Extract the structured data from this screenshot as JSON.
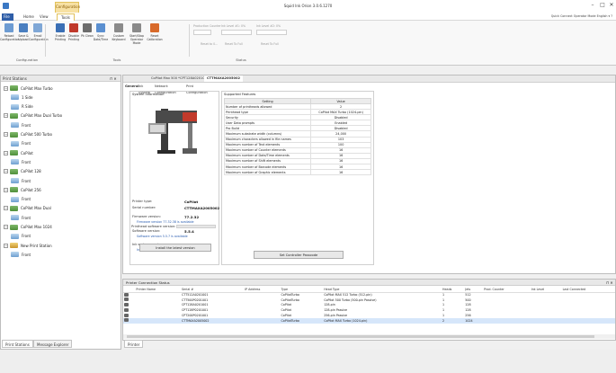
{
  "window": {
    "title": "Squid Ink Orion 3.0.6.1270",
    "context_group": "Configuration",
    "controls": [
      "–",
      "□",
      "✕"
    ]
  },
  "menu": {
    "file": "File ▾",
    "home": "Home",
    "view": "View",
    "tools": "Tools",
    "quick_connect": "Quick Connect  Operator Mode  English ▾  ?"
  },
  "ribbon": {
    "buttons": [
      {
        "label": "Reload Configuration",
        "color": "#6c9bd2"
      },
      {
        "label": "Save & Upload",
        "color": "#4a7fc0"
      },
      {
        "label": "Email Configuration",
        "color": "#7fa7d6"
      },
      {
        "label": "Enable Printing",
        "color": "#3a6fb5"
      },
      {
        "label": "Disable Printing",
        "color": "#c0392b"
      },
      {
        "label": "Pk Clean",
        "color": "#6c6c6c"
      },
      {
        "label": "Sync Date/Time",
        "color": "#5a8fd0"
      },
      {
        "label": "Custom Keyboard",
        "color": "#8a8a8a"
      },
      {
        "label": "Start/Stop Operator Mode",
        "color": "#8a8a8a"
      },
      {
        "label": "Reset Calibration",
        "color": "#d86a2a"
      }
    ],
    "groups": {
      "configuration": "Configuration",
      "tools": "Tools",
      "status": "Status"
    },
    "production_counter": "Production Counter",
    "reset_to": "Reset to 0...",
    "ink_level_1": "Ink Level #1: 0%",
    "ink_level_2": "Ink Level #2: 0%",
    "reset_to_full": "Reset To Full"
  },
  "left_panel": {
    "title": "Print Stations",
    "tree": [
      {
        "label": "CoPilot Max Turbo",
        "type": "printer",
        "level": 0
      },
      {
        "label": "1 Side",
        "type": "head",
        "level": 1
      },
      {
        "label": "R Side",
        "type": "head",
        "level": 1
      },
      {
        "label": "CoPilot Max Dual Turbo",
        "type": "printer",
        "level": 0
      },
      {
        "label": "Front",
        "type": "head",
        "level": 1
      },
      {
        "label": "CoPilot 500 Turbo",
        "type": "printer",
        "level": 0
      },
      {
        "label": "Front",
        "type": "head",
        "level": 1
      },
      {
        "label": "CoPilot",
        "type": "printer",
        "level": 0
      },
      {
        "label": "Front",
        "type": "head",
        "level": 1
      },
      {
        "label": "CoPilot 128",
        "type": "printer",
        "level": 0
      },
      {
        "label": "Front",
        "type": "head",
        "level": 1
      },
      {
        "label": "CoPilot 256",
        "type": "printer",
        "level": 0
      },
      {
        "label": "Front",
        "type": "head",
        "level": 1
      },
      {
        "label": "CoPilot Max Dual",
        "type": "printer",
        "level": 0
      },
      {
        "label": "Front",
        "type": "head",
        "level": 1
      },
      {
        "label": "CoPilot Max 1024",
        "type": "printer",
        "level": 0
      },
      {
        "label": "Front",
        "type": "head",
        "level": 1
      },
      {
        "label": "New Print Station",
        "type": "station",
        "level": 0
      },
      {
        "label": "Front",
        "type": "head",
        "level": 1
      }
    ],
    "tabs": [
      "Print Stations",
      "Message Explorer"
    ]
  },
  "doc_tabs": [
    "CoPilot Max 500 *",
    "CPT128A0201001",
    "CTTMAXA2005002"
  ],
  "sub_tabs": [
    "General",
    "Ink System",
    "Network Configuration",
    "Print Configuration"
  ],
  "system_info": {
    "title": "System Information",
    "printer_type_label": "Printer type:",
    "printer_type": "CoPilot",
    "serial_label": "Serial number:",
    "serial": "CTTMAXA2005002",
    "firmware_label": "Firmware version:",
    "firmware": "77.2.32",
    "firmware_note": "Firmware version 77.32.38 is available",
    "software_label": "Software version:",
    "software": "5.5.4",
    "software_note": "Software version 5.5.7 is available",
    "ink_label": "Ink system version:",
    "ink": "18",
    "ink_note": "Ink system configuration version 35 is available",
    "printhead_label": "Printhead software version:",
    "install_button": "Install the latest version"
  },
  "features": {
    "title": "Supported Features",
    "headers": [
      "Setting",
      "Value"
    ],
    "rows": [
      [
        "Number of printheads allowed",
        "2"
      ],
      [
        "Printhead type",
        "CoPilot MAX Turbo (1024-pin)"
      ],
      [
        "Security",
        "Disabled"
      ],
      [
        "User Data prompts",
        "Enabled"
      ],
      [
        "Pro Build",
        "Disabled"
      ],
      [
        "Maximum substrate width (columns)",
        "24,000"
      ],
      [
        "Maximum characters allowed in file names",
        "103"
      ],
      [
        "Maximum number of Text elements",
        "100"
      ],
      [
        "Maximum number of Counter elements",
        "16"
      ],
      [
        "Maximum number of Date/Time elements",
        "16"
      ],
      [
        "Maximum number of Shift elements",
        "16"
      ],
      [
        "Maximum number of Barcode elements",
        "16"
      ],
      [
        "Maximum number of Graphic elements",
        "16"
      ]
    ],
    "passcode_button": "Set Controller Passcode"
  },
  "connection_status": {
    "title": "Printer Connection Status",
    "headers": [
      "",
      "Printer Name",
      "Serial #",
      "IP Address",
      "Type",
      "Head Type",
      "Heads",
      "Jets",
      "Prod. Counter",
      "Ink Level",
      "Last Connected"
    ],
    "rows": [
      [
        "",
        "",
        "CTT512A0201001",
        "",
        "CoPilotTurbo",
        "CoPilot MAX 512 Turbo (512-pin)",
        "1",
        "512",
        "",
        "",
        ""
      ],
      [
        "",
        "",
        "CTT500P0201001",
        "",
        "CoPilotTurbo",
        "CoPilot 500 Turbo (500-pin Passive)",
        "1",
        "500",
        "",
        "",
        ""
      ],
      [
        "",
        "",
        "CPT128A0201001",
        "",
        "CoPilot",
        "128-pin",
        "1",
        "128",
        "",
        "",
        ""
      ],
      [
        "",
        "",
        "CPT128P0201001",
        "",
        "CoPilot",
        "128-pin Passive",
        "1",
        "128",
        "",
        "",
        ""
      ],
      [
        "",
        "",
        "CPT200P0201001",
        "",
        "CoPilot",
        "256-pin Passive",
        "1",
        "256",
        "",
        "",
        ""
      ],
      [
        "",
        "",
        "CTTMAXA2005002",
        "",
        "CoPilotTurbo",
        "CoPilot MAX Turbo (1024-pin)",
        "2",
        "1024",
        "",
        "",
        ""
      ]
    ],
    "selected_row": 5,
    "bottom_tab": "Printer List"
  },
  "colors": {
    "accent": "#2f5ea8",
    "context_tab": "#f7e1a3",
    "link": "#2a5db0"
  }
}
